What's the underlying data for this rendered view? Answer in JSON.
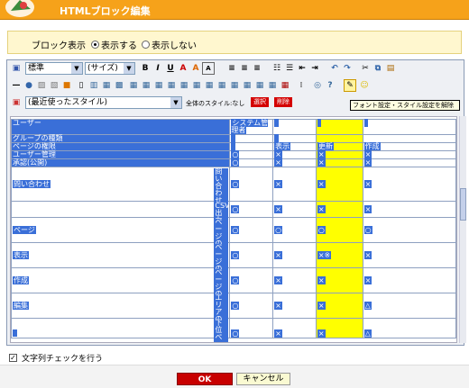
{
  "window": {
    "title": "HTMLブロック編集"
  },
  "block_display": {
    "label": "ブロック表示",
    "options": [
      "表示する",
      "表示しない"
    ],
    "selected": "表示する"
  },
  "toolbar": {
    "format": "標準",
    "size": "(サイズ)",
    "style": "(最近使ったスタイル)",
    "all_style_label": "全体のスタイル:なし",
    "select_btn": "選択",
    "delete_btn": "削除",
    "tooltip": "フォント設定・スタイル設定を解除"
  },
  "table": {
    "headers": [
      "ユーザー",
      "システム管理者",
      "",
      "",
      ""
    ],
    "rows": [
      [
        "グループの種類",
        "",
        "",
        "",
        ""
      ],
      [
        "ページの権限",
        "",
        "表示",
        "更新",
        "作成"
      ],
      [
        "ユーザー管理",
        "○",
        "×",
        "×",
        "×"
      ],
      [
        "承認(公開)",
        "○",
        "×",
        "×",
        "×"
      ],
      [
        "問い合わせ",
        "問い合わせ対応",
        "○",
        "×",
        "×"
      ],
      [
        "",
        "CSV出力",
        "○",
        "×",
        "×"
      ],
      [
        "ページ",
        "ページの表示",
        "○",
        "○",
        "○"
      ],
      [
        "表示",
        "ページの削除",
        "○",
        "×",
        "×※"
      ],
      [
        "作成",
        "ページの移動",
        "○",
        "×",
        "×"
      ],
      [
        "編集",
        "エリアの変更",
        "○",
        "×",
        "×"
      ],
      [
        "",
        "下位ページ",
        "○",
        "×",
        "×"
      ]
    ],
    "extra_col": [
      "×",
      "×",
      "○",
      "×",
      "×",
      "×",
      "△",
      "△"
    ]
  },
  "check": {
    "label": "文字列チェックを行う",
    "checked": true
  },
  "buttons": {
    "ok": "OK",
    "cancel": "キャンセル"
  }
}
